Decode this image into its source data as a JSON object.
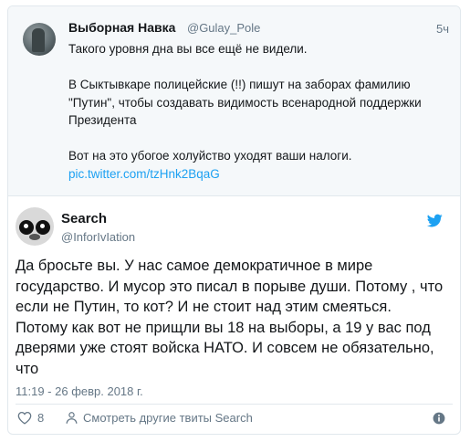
{
  "quoted": {
    "name": "Выборная Навка",
    "handle": "@Gulay_Pole",
    "time": "5ч",
    "p1": "Такого уровня дна вы все ещё не видели.",
    "p2": "В Сыктывкаре полицейские (!!) пишут на заборах фамилию \"Путин\", чтобы создавать видимость всенародной поддержки Президента",
    "p3": "Вот на это убогое холуйство уходят ваши налоги.",
    "link": "pic.twitter.com/tzHnk2BqaG"
  },
  "tweet": {
    "name": "Search",
    "handle": "@InforIvIation",
    "text": "Да бросьте вы. У нас самое демократичное в мире\nгосударство. И мусор это писал в порыве души. Потому , что\nесли не Путин, то кот? И не стоит над этим смеяться.\nПотому как вот не прищли вы 18 на выборы, а 19 у вас под\nдверями уже стоят войска НАТО. И совсем не обязательно,\nчто",
    "date": "11:19 - 26 февр. 2018 г."
  },
  "footer": {
    "likes": "8",
    "more_tweets": "Смотреть другие твиты Search"
  },
  "icons": {
    "heart": "heart-icon",
    "person": "person-icon",
    "twitter": "twitter-bird-icon",
    "info": "info-icon"
  },
  "colors": {
    "link": "#1da1f2",
    "muted": "#657786",
    "border": "#e1e8ed",
    "quoted_bg": "#f5f8fa"
  }
}
